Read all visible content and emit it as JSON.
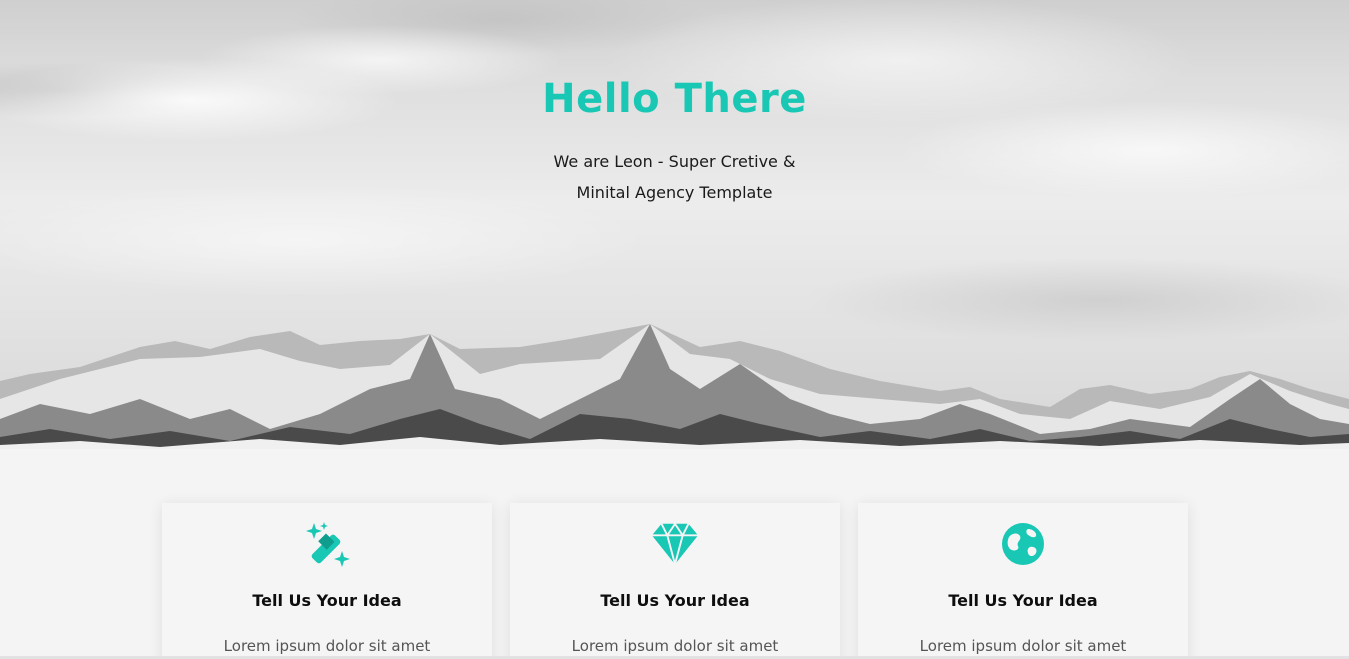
{
  "hero": {
    "title": "Hello There",
    "subtitle_line1": "We are Leon - Super Cretive &",
    "subtitle_line2": "Minital Agency Template",
    "title_color": "#18c7b4"
  },
  "features": [
    {
      "icon": "magic-wand-icon",
      "title": "Tell Us Your Idea",
      "text": "Lorem ipsum dolor sit amet"
    },
    {
      "icon": "diamond-icon",
      "title": "Tell Us Your Idea",
      "text": "Lorem ipsum dolor sit amet"
    },
    {
      "icon": "globe-icon",
      "title": "Tell Us Your Idea",
      "text": "Lorem ipsum dolor sit amet"
    }
  ],
  "accent_color": "#18c7b4"
}
